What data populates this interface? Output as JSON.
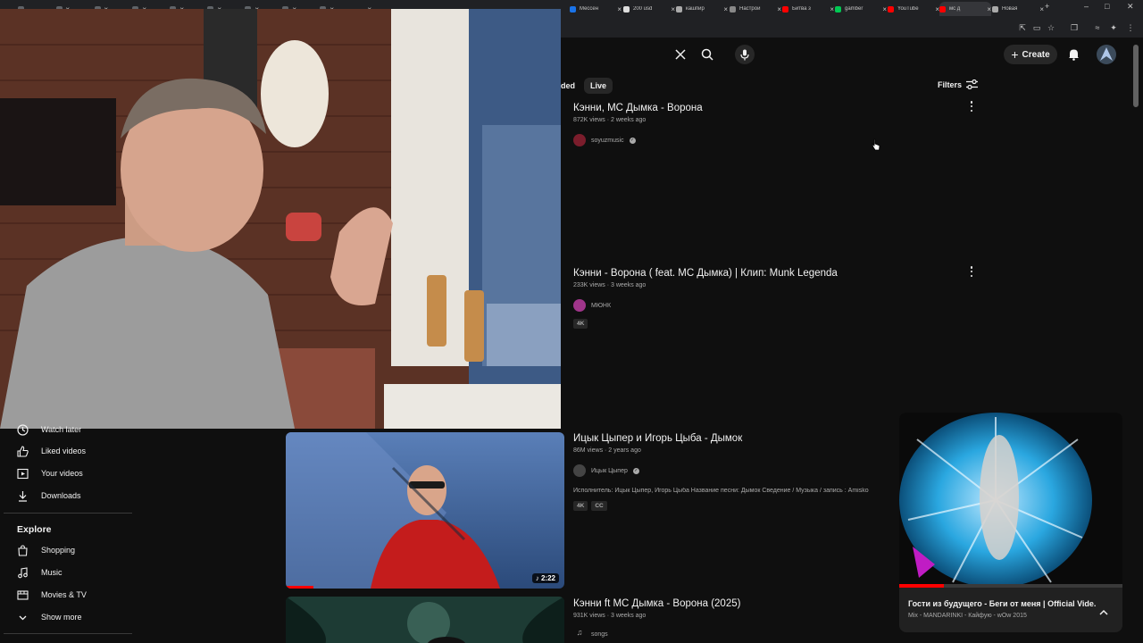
{
  "browser": {
    "tabs": [
      {
        "label": "",
        "color": "#5f6368"
      },
      {
        "label": "",
        "color": "#5f6368"
      },
      {
        "label": "",
        "color": "#5f6368"
      },
      {
        "label": "",
        "color": "#5f6368"
      },
      {
        "label": "",
        "color": "#5f6368"
      },
      {
        "label": "",
        "color": "#5f6368"
      },
      {
        "label": "",
        "color": "#5f6368"
      },
      {
        "label": "",
        "color": "#5f6368"
      },
      {
        "label": "",
        "color": "#5f6368"
      },
      {
        "label": "Мессен",
        "color": "#1a73e8"
      },
      {
        "label": "200 usd",
        "color": "#dddddd"
      },
      {
        "label": "кашпир",
        "color": "#aaaaaa"
      },
      {
        "label": "Настрой",
        "color": "#888888"
      },
      {
        "label": "Битва з",
        "color": "#ff0000"
      },
      {
        "label": "gamber",
        "color": "#00c853"
      },
      {
        "label": "YouTube",
        "color": "#ff0000"
      },
      {
        "label": "мс д",
        "color": "#ff0000"
      },
      {
        "label": "Новая",
        "color": "#aaaaaa"
      }
    ],
    "new_tab": "+",
    "window_controls": [
      "–",
      "□",
      "✕"
    ]
  },
  "search": {
    "clear_icon": "close-icon",
    "search_icon": "search-icon",
    "mic_icon": "mic-icon"
  },
  "header": {
    "create_label": "Create",
    "notifications_icon": "bell-icon"
  },
  "chips": [
    {
      "label": "ded"
    },
    {
      "label": "Live"
    }
  ],
  "filters_label": "Filters",
  "results": [
    {
      "title": "Кэнни, МС Дымка - Ворона",
      "meta": "872K views · 2 weeks ago",
      "channel": "soyuzmusic",
      "verified": true,
      "avatar_color": "#7b1d2c"
    },
    {
      "title": "Кэнни - Ворона ( feat. MC Дымка) | Клип: Munk Legenda",
      "meta": "233K views · 3 weeks ago",
      "channel": "МЮНК",
      "verified": false,
      "avatar_color": "#a0358a",
      "badges": [
        "4K"
      ]
    },
    {
      "title": "Ицык Цыпер и Игорь Цыба - Дымок",
      "meta": "86M views · 2 years ago",
      "channel": "Ицык Цыпер",
      "verified": true,
      "avatar_color": "#444444",
      "description": "Исполнитель: Ицык Цыпер, Игорь Цыба Название песни: Дымок Сведение / Музыка / запись : Amisko",
      "badges": [
        "4K",
        "CC"
      ]
    },
    {
      "title": "Кэнни ft МС Дымка - Ворона (2025)",
      "meta": "931K views · 3 weeks ago",
      "channel": "songs",
      "verified": false,
      "avatar_color": "#555555"
    }
  ],
  "thumbs": [
    {
      "duration": "2:22",
      "progress": 0.1
    }
  ],
  "sidebar": {
    "items": [
      {
        "label": "Watch later",
        "icon": "clock-icon"
      },
      {
        "label": "Liked videos",
        "icon": "thumb-up-icon"
      },
      {
        "label": "Your videos",
        "icon": "play-box-icon"
      },
      {
        "label": "Downloads",
        "icon": "download-icon"
      }
    ],
    "explore_heading": "Explore",
    "explore": [
      {
        "label": "Shopping",
        "icon": "shopping-bag-icon"
      },
      {
        "label": "Music",
        "icon": "music-icon"
      },
      {
        "label": "Movies & TV",
        "icon": "film-icon"
      },
      {
        "label": "Show more",
        "icon": "chevron-down-icon"
      }
    ]
  },
  "miniplayer": {
    "title": "Гости из будущего - Беги от меня | Official Vide...",
    "subtitle": "Mix - MANDARINKI - Кайфую - wOw 2015",
    "progress": 0.2
  }
}
